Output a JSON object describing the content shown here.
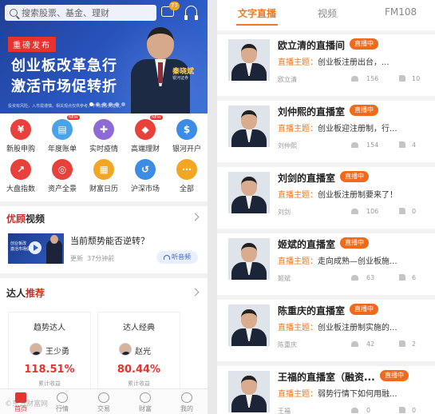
{
  "left": {
    "search": {
      "placeholder": "搜索股票、基金、理财"
    },
    "message_badge": "77",
    "banner": {
      "tag": "重磅发布",
      "title_line1": "创业板改革急行",
      "title_line2": "激活市场促转折",
      "speaker_name": "秦晓斌",
      "speaker_org": "银河证券",
      "disclaimer": "投资有风险，入市需谨慎。相关观点仅供参考，不构成投资建议。"
    },
    "quick_menu": [
      {
        "label": "新股申购",
        "icon": "ipo-icon",
        "color": "#e8403a",
        "new": false
      },
      {
        "label": "年度账单",
        "icon": "bill-icon",
        "color": "#4aa3e8",
        "new": true
      },
      {
        "label": "实时疫情",
        "icon": "epidemic-icon",
        "color": "#8d6ad8",
        "new": false
      },
      {
        "label": "高端理财",
        "icon": "diamond-icon",
        "color": "#e8403a",
        "new": true
      },
      {
        "label": "银河开户",
        "icon": "account-icon",
        "color": "#3c8ce6",
        "new": false
      },
      {
        "label": "大盘指数",
        "icon": "index-icon",
        "color": "#e8403a",
        "new": false
      },
      {
        "label": "资产全景",
        "icon": "asset-icon",
        "color": "#e8403a",
        "new": false
      },
      {
        "label": "财富日历",
        "icon": "calendar-icon",
        "color": "#f2a623",
        "new": false
      },
      {
        "label": "沪深市场",
        "icon": "market-icon",
        "color": "#3c8ce6",
        "new": false
      },
      {
        "label": "全部",
        "icon": "all-icon",
        "color": "#f2a623",
        "new": false
      }
    ],
    "new_badge": "NEW",
    "video_section": {
      "title_a": "优顾",
      "title_b": "视频",
      "thumb_text_1": "创业板改",
      "thumb_text_2": "激活市场促转",
      "video_title": "当前颓势能否逆转？",
      "update_label": "更新",
      "update_time": "37分钟前",
      "listen_label": "听音频"
    },
    "talent_section": {
      "title_a": "达人",
      "title_b": "推荐",
      "cards": [
        {
          "title": "趋势达人",
          "name": "王少勇",
          "return": "118.51%",
          "caption": "累计收益"
        },
        {
          "title": "达人经典",
          "name": "赵光",
          "return": "80.44%",
          "caption": "累计收益"
        }
      ]
    },
    "tabbar": [
      {
        "label": "首页",
        "active": true
      },
      {
        "label": "行情",
        "active": false
      },
      {
        "label": "交易",
        "active": false
      },
      {
        "label": "财富",
        "active": false
      },
      {
        "label": "我的",
        "active": false
      }
    ],
    "watermark": "©东方财富网"
  },
  "right": {
    "tabs": [
      {
        "label": "文字直播",
        "active": true
      },
      {
        "label": "视频",
        "active": false
      },
      {
        "label": "FM108",
        "active": false
      }
    ],
    "live_label": "直播中",
    "topic_key": "直播主题：",
    "rooms": [
      {
        "title": "欧立清的直播间",
        "topic": "创业板注册出台，...",
        "host": "欧立清",
        "viewers": "156",
        "likes": "10"
      },
      {
        "title": "刘仲熙的直播室",
        "topic": "创业板迎注册制，行...",
        "host": "刘仲熙",
        "viewers": "154",
        "likes": "4"
      },
      {
        "title": "刘剑的直播室",
        "topic": "创业板注册制要来了！",
        "host": "刘剑",
        "viewers": "106",
        "likes": "0"
      },
      {
        "title": "姬斌的直播室",
        "topic": "走向成熟—创业板施...",
        "host": "姬斌",
        "viewers": "63",
        "likes": "6"
      },
      {
        "title": "陈重庆的直播室",
        "topic": "创业板注册制实施的...",
        "host": "陈重庆",
        "viewers": "42",
        "likes": "2"
      },
      {
        "title": "王福的直播室（融资...",
        "topic": "弱势行情下如何用融...",
        "host": "王福",
        "viewers": "0",
        "likes": "0"
      }
    ]
  }
}
